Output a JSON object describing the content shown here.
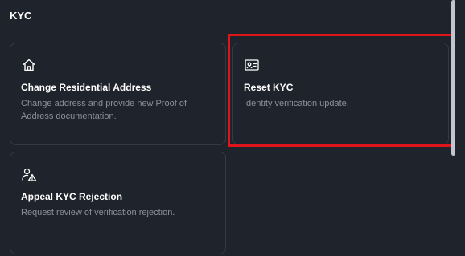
{
  "section": {
    "title": "KYC"
  },
  "cards": [
    {
      "icon": "home-icon",
      "title": "Change Residential Address",
      "description": "Change address and provide new Proof of Address documentation."
    },
    {
      "icon": "id-card-icon",
      "title": "Reset KYC",
      "description": "Identity verification update."
    },
    {
      "icon": "user-warning-icon",
      "title": "Appeal KYC Rejection",
      "description": "Request review of verification rejection."
    }
  ],
  "colors": {
    "background": "#1f232b",
    "card_border": "#343a44",
    "title_text": "#ffffff",
    "description_text": "#8b919b",
    "highlight": "#e0141b",
    "scrollbar_thumb": "#c2c5cb"
  }
}
